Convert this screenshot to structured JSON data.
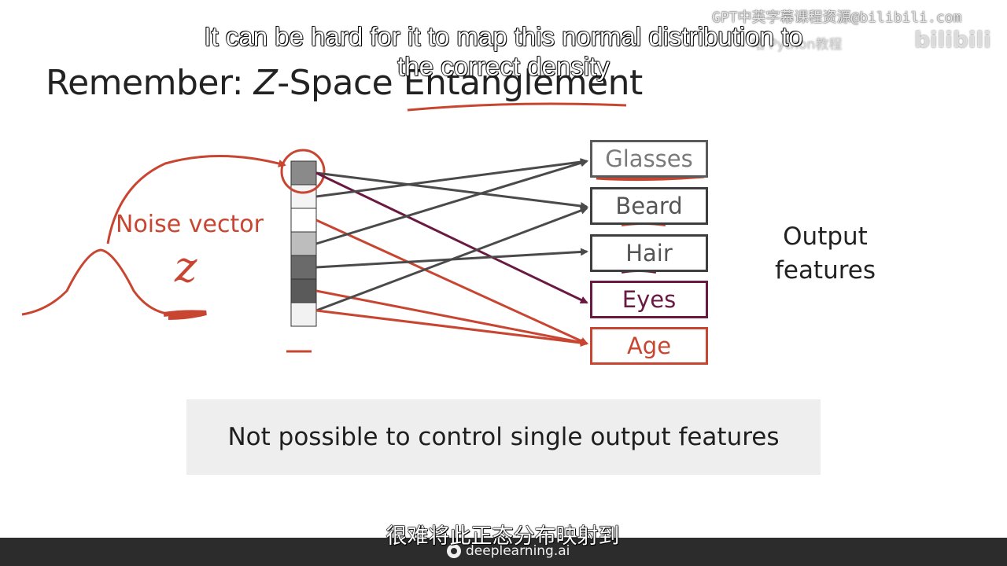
{
  "slide": {
    "title_prefix": "Remember: ",
    "title_italic": "Z",
    "title_suffix": "-Space Entanglement",
    "noise_label": "Noise vector",
    "z_symbol": "z",
    "output_label_line1": "Output",
    "output_label_line2": "features",
    "features": [
      {
        "label": "Glasses",
        "color": "#5a5a5a",
        "text_color": "#7a7a7a"
      },
      {
        "label": "Beard",
        "color": "#3e3e3e",
        "text_color": "#555555"
      },
      {
        "label": "Hair",
        "color": "#3e3e3e",
        "text_color": "#555555"
      },
      {
        "label": "Eyes",
        "color": "#6a1a42",
        "text_color": "#6a1a42"
      },
      {
        "label": "Age",
        "color": "#c84631",
        "text_color": "#c84631"
      }
    ],
    "banner_text": "Not possible to control single output features"
  },
  "subtitles": {
    "english": "It can be hard for it to map this normal distribution to the correct density",
    "chinese": "很难将此正态分布映射到"
  },
  "watermark": {
    "text": "GPT中英字幕课程资源@bilibili.com",
    "sub": "咕 Python教程",
    "platform": "bilibili"
  },
  "footer": {
    "logo_text": "deeplearning.ai"
  },
  "colors": {
    "accent_red": "#c84631",
    "accent_purple": "#6a1a42",
    "grey_line": "#4a4a4a"
  }
}
